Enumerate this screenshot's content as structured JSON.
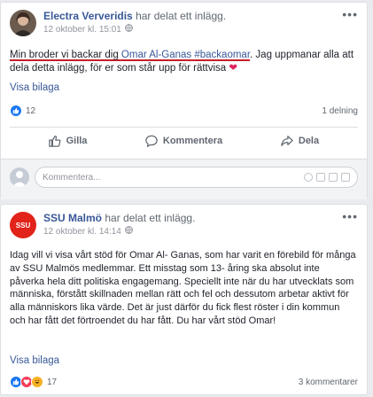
{
  "post1": {
    "author": "Electra Ververidis",
    "action": "har delat ett inlägg.",
    "timestamp": "12 oktober kl. 15:01",
    "text_part1": "Min broder vi backar dig ",
    "mention": "Omar Al-Ganas",
    "hashtag": "#backaomar",
    "text_part2": ". Jag uppmanar alla att dela detta inlägg, för er som står upp för rättvisa ",
    "heart_emoji": "❤",
    "show_attachment": "Visa bilaga",
    "reaction_count": "12",
    "share_count": "1 delning",
    "like_label": "Gilla",
    "comment_label": "Kommentera",
    "share_label": "Dela",
    "comment_placeholder": "Kommentera..."
  },
  "post2": {
    "author": "SSU Malmö",
    "action": "har delat ett inlägg.",
    "timestamp": "12 oktober kl. 14:14",
    "body": "Idag vill vi visa vårt stöd för Omar Al- Ganas, som har varit en förebild för många av SSU Malmös medlemmar. Ett misstag som 13- åring ska absolut inte påverka hela ditt politiska engagemang. Speciellt inte när du har utvecklats som människa, förstått skillnaden mellan rätt och fel och dessutom arbetar aktivt för alla människors lika värde. Det är just därför du fick flest röster i din kommun och har fått det förtroendet du har fått. Du har vårt stöd Omar!",
    "show_attachment": "Visa bilaga",
    "reaction_count": "17",
    "comment_count": "3 kommentarer",
    "avatar_text": "SSU"
  },
  "colors": {
    "link": "#385898",
    "like": "#1877f2",
    "love": "#f33e58",
    "haha": "#f7b125",
    "ssu_red": "#e2231a",
    "underline_red": "#c3202b"
  }
}
